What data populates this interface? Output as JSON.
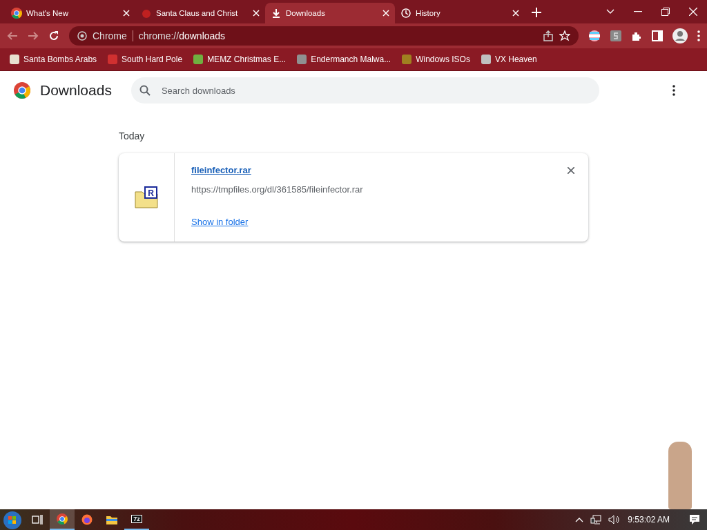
{
  "tabs": [
    {
      "title": "What's New",
      "kind": "chrome",
      "selected": false
    },
    {
      "title": "Santa Claus and Christ",
      "kind": "site",
      "selected": false
    },
    {
      "title": "Downloads",
      "kind": "download",
      "selected": true
    },
    {
      "title": "History",
      "kind": "history",
      "selected": false
    }
  ],
  "address_bar": {
    "site_label": "Chrome",
    "url_scheme": "chrome://",
    "url_path": "downloads"
  },
  "bookmarks": [
    {
      "title": "Santa Bombs Arabs",
      "color": "#e8e0d0"
    },
    {
      "title": "South Hard Pole",
      "color": "#d03030"
    },
    {
      "title": "MEMZ Christmas E...",
      "color": "#70b040"
    },
    {
      "title": "Endermanch Malwa...",
      "color": "#909090"
    },
    {
      "title": "Windows ISOs",
      "color": "#a08020"
    },
    {
      "title": "VX Heaven",
      "color": "#c0c0c0"
    }
  ],
  "page": {
    "title": "Downloads",
    "search": {
      "placeholder": "Search downloads"
    },
    "section_heading": "Today",
    "downloads": [
      {
        "file_name": "fileinfector.rar",
        "icon_letter": "R",
        "url": "https://tmpfiles.org/dl/361585/fileinfector.rar",
        "action": "Show in folder"
      }
    ]
  },
  "taskbar": {
    "apps": [
      {
        "kind": "chrome",
        "selected": true,
        "running": true
      },
      {
        "kind": "firefox",
        "selected": false,
        "running": false
      },
      {
        "kind": "explorer",
        "selected": false,
        "running": false
      },
      {
        "kind": "archiver",
        "selected": false,
        "running": true,
        "label": "7z"
      }
    ],
    "clock": "9:53:02 AM"
  }
}
